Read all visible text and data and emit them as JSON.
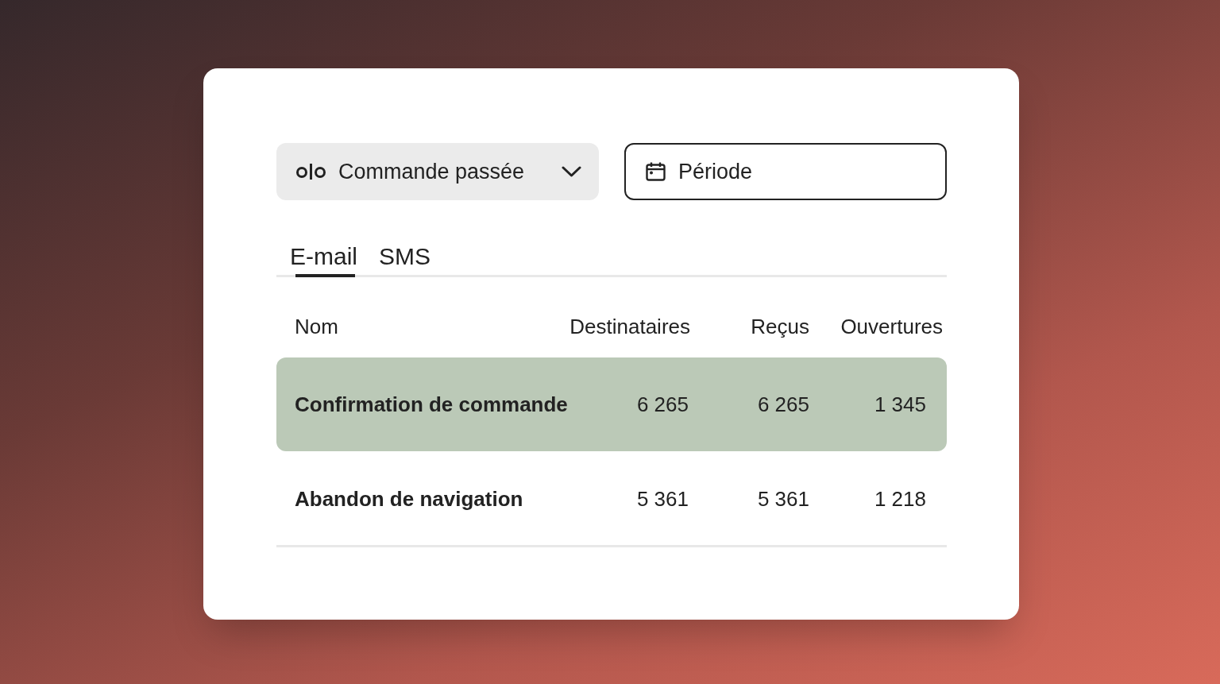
{
  "event_select": {
    "label": "Commande passée"
  },
  "period_button": {
    "label": "Période"
  },
  "tabs": [
    {
      "label": "E-mail",
      "selected": true
    },
    {
      "label": "SMS",
      "selected": false
    }
  ],
  "table": {
    "columns": [
      "Nom",
      "Destinataires",
      "Reçus",
      "Ouvertures"
    ],
    "rows": [
      {
        "cells": [
          "Confirmation de commande",
          "6 265",
          "6 265",
          "1 345"
        ],
        "selected": true
      },
      {
        "cells": [
          "Abandon de navigation",
          "5 361",
          "5 361",
          "1 218"
        ],
        "selected": false
      }
    ]
  }
}
